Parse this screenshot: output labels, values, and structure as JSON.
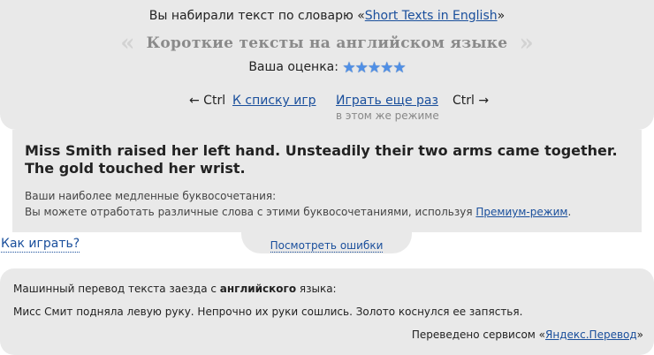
{
  "header": {
    "dict_prefix": "Вы набирали текст по словарю «",
    "dict_link": "Short Texts in English",
    "dict_suffix": "»",
    "title": "Короткие тексты на английском языке",
    "left_quote": "«",
    "right_quote": "»",
    "rating_label": "Ваша оценка:",
    "rating_stars": 5,
    "rating_max": 5,
    "star_color": "#4f8fe6"
  },
  "nav": {
    "left_hint": "← Ctrl",
    "list_link": "К списку игр",
    "again_link": "Играть еще раз",
    "again_sub": "в этом же режиме",
    "right_hint": "Ctrl →"
  },
  "result": {
    "text": "Miss Smith raised her left hand. Unsteadily their two arms came together. The gold touched her wrist.",
    "slow_label": "Ваши наиболее медленные буквосочетания:",
    "slow_desc_prefix": "Вы можете отработать различные слова с этими буквосочетаниями, используя ",
    "premium_link": "Премиум-режим",
    "slow_desc_suffix": "."
  },
  "errors_tab": "Посмотреть ошибки",
  "how_to_play": "Как играть?",
  "translation": {
    "header_prefix": "Машинный перевод текста заезда с ",
    "header_bold": "английского",
    "header_suffix": " языка:",
    "text": "Мисс Смит подняла левую руку. Непрочно их руки сошлись. Золото коснулся ее запястья.",
    "credit_prefix": "Переведено сервисом «",
    "credit_link": "Яндекс.Перевод",
    "credit_suffix": "»"
  },
  "colors": {
    "panel_bg": "#e9e9e9",
    "link": "#1a4f9c",
    "title_gray": "#8a8a8a"
  }
}
